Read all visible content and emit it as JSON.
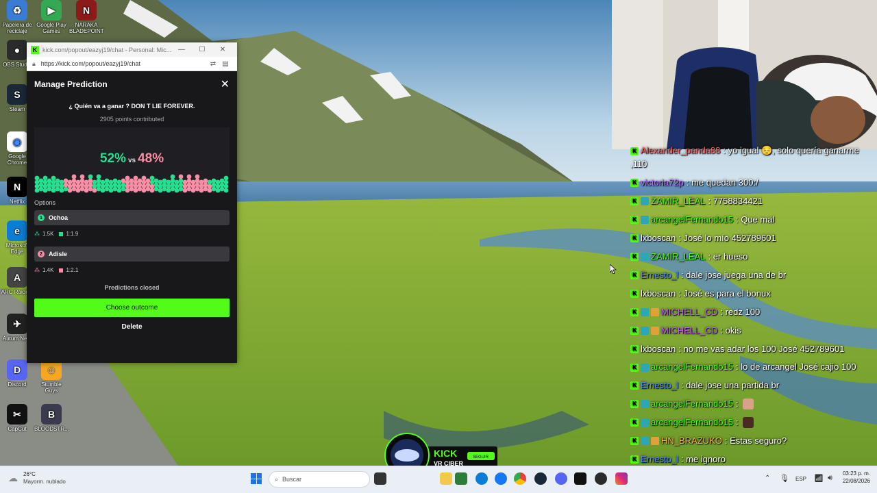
{
  "browser": {
    "title": "kick.com/popout/eazyj19/chat - Personal: Mic...",
    "url": "https://kick.com/popout/eazyj19/chat"
  },
  "prediction": {
    "header": "Manage Prediction",
    "question": "¿ Quién va a ganar ? DON T LIE FOREVER.",
    "points": "2905 points contributed",
    "pct_a": "52%",
    "vs": "vs",
    "pct_b": "48%",
    "split_fraction_a": 0.52,
    "options_label": "Options",
    "options": [
      {
        "num": "1",
        "name": "Ochoa",
        "points": "1.5K",
        "ratio": "1:1.9",
        "color": "#27e08f"
      },
      {
        "num": "2",
        "name": "Adisle",
        "points": "1.4K",
        "ratio": "1:2.1",
        "color": "#f98ea6"
      }
    ],
    "status": "Predictions closed",
    "choose_label": "Choose outcome",
    "delete_label": "Delete"
  },
  "desktop": {
    "icons": [
      {
        "label": "Papelera de reciclaje",
        "color": "#3a7bd5",
        "glyph": "♻"
      },
      {
        "label": "Google Play Games",
        "color": "#34a853",
        "glyph": "▶"
      },
      {
        "label": "NARAKA BLADEPOINT",
        "color": "#8b1a1a",
        "glyph": "N"
      },
      {
        "label": "OBS Studio",
        "color": "#2b2b2b",
        "glyph": "●"
      },
      {
        "label": "Steam",
        "color": "#1b2838",
        "glyph": "S"
      },
      {
        "label": "Google Chrome",
        "color": "#ffffff",
        "glyph": "◉"
      },
      {
        "label": "Netflix",
        "color": "#000000",
        "glyph": "N"
      },
      {
        "label": "Microsoft Edge",
        "color": "#0c7cd5",
        "glyph": "e"
      },
      {
        "label": "ARC Raiders",
        "color": "#444444",
        "glyph": "A"
      },
      {
        "label": "Autum Ne...",
        "color": "#222222",
        "glyph": "✈"
      },
      {
        "label": "Discord",
        "color": "#5865f2",
        "glyph": "D"
      },
      {
        "label": "Stumble Guys",
        "color": "#f5a623",
        "glyph": "☺"
      },
      {
        "label": "CapCut",
        "color": "#111111",
        "glyph": "✂"
      },
      {
        "label": "BLOODSTR...",
        "color": "#3b3b50",
        "glyph": "B"
      }
    ]
  },
  "chat": [
    {
      "user": "Alexander_panda88",
      "color": "#ff5c5c",
      "text": ": yo igual 😔, solo quería ganarme ,110",
      "badges": [
        "kick"
      ],
      "wrap": true
    },
    {
      "user": "victoria72p",
      "color": "#b66cff",
      "text": ": me quedan 300:/",
      "badges": [
        "kick"
      ]
    },
    {
      "user": "ZAMIR_LEAL",
      "color": "#53fc18",
      "text": ": 7758834421",
      "badges": [
        "kick",
        "sub"
      ]
    },
    {
      "user": "arcangelFernando15",
      "color": "#53fc18",
      "text": ": Que mal",
      "badges": [
        "kick",
        "sub"
      ]
    },
    {
      "user": "lxboscan",
      "color": "#ffffff",
      "text": ": José lo mío 452789601",
      "badges": [
        "kick"
      ]
    },
    {
      "user": "ZAMIR_LEAL",
      "color": "#53fc18",
      "text": ": er hueso",
      "badges": [
        "kick",
        "sub"
      ]
    },
    {
      "user": "Ernesto_l",
      "color": "#4f8cff",
      "text": ": dale jose juega una de br",
      "badges": [
        "kick"
      ]
    },
    {
      "user": "lxboscan",
      "color": "#ffffff",
      "text": ": José es para el bonux",
      "badges": [
        "kick"
      ]
    },
    {
      "user": "MICHELL_CD",
      "color": "#c45cff",
      "text": ": redz 100",
      "badges": [
        "kick",
        "sub",
        "gift"
      ]
    },
    {
      "user": "MICHELL_CD",
      "color": "#c45cff",
      "text": ": okis",
      "badges": [
        "kick",
        "sub",
        "gift"
      ]
    },
    {
      "user": "lxboscan",
      "color": "#ffffff",
      "text": ": no me vas adar los 100 José 452789601",
      "badges": [
        "kick"
      ]
    },
    {
      "user": "arcangelFernando15",
      "color": "#53fc18",
      "text": ": lo de arcangel José cajio 100",
      "badges": [
        "kick",
        "sub"
      ],
      "wrap": true
    },
    {
      "user": "Ernesto_l",
      "color": "#4f8cff",
      "text": ": dale jose una partida br",
      "badges": [
        "kick"
      ]
    },
    {
      "user": "arcangelFernando15",
      "color": "#53fc18",
      "text": ":",
      "badges": [
        "kick",
        "sub"
      ],
      "emote": "#d9a08a"
    },
    {
      "user": "arcangelFernando15",
      "color": "#53fc18",
      "text": ":",
      "badges": [
        "kick",
        "sub"
      ],
      "emote": "#4a2a22"
    },
    {
      "user": "HN_BRAZUKO",
      "color": "#ffb347",
      "text": ": Estas seguro?",
      "badges": [
        "kick",
        "sub",
        "gift"
      ]
    },
    {
      "user": "Ernesto_l",
      "color": "#4f8cff",
      "text": ": me ignoro",
      "badges": [
        "kick"
      ]
    }
  ],
  "overlay": {
    "kick_text": "KICK",
    "kick_sub": "VR CIBER",
    "kick_tag": "SEGUIR"
  },
  "taskbar": {
    "temp": "26°C",
    "weather": "Mayorm. nublado",
    "search_placeholder": "Buscar",
    "lang": "ESP",
    "time": "03:23 p. m.",
    "date": "22/08/2026"
  }
}
